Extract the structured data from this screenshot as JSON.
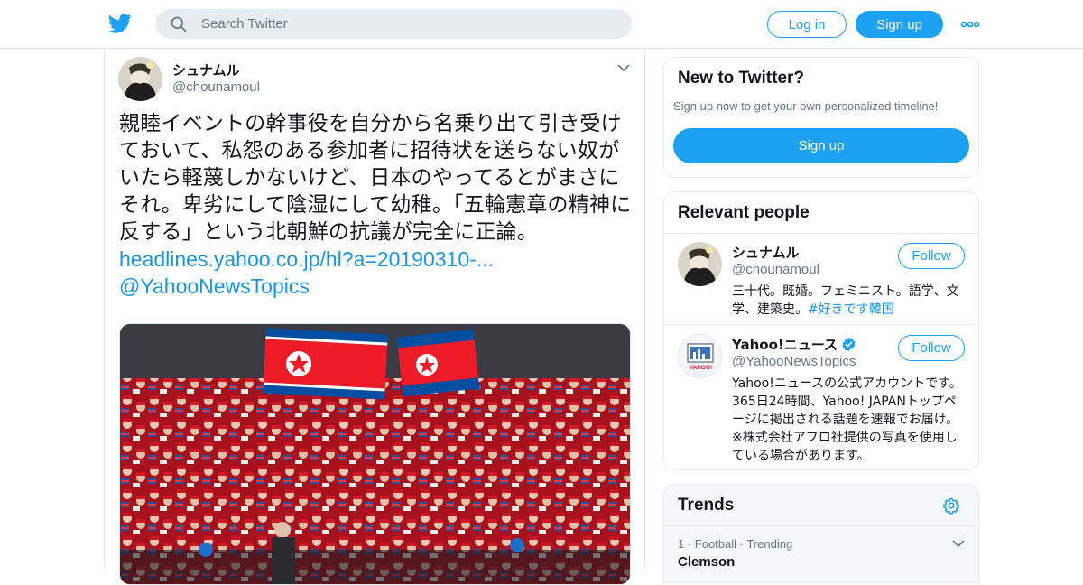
{
  "header": {
    "search_placeholder": "Search Twitter",
    "login_label": "Log in",
    "signup_label": "Sign up"
  },
  "tweet": {
    "author_name": "シュナムル",
    "author_handle": "@chounamoul",
    "text": "親睦イベントの幹事役を自分から名乗り出て引き受けておいて、私怨のある参加者に招待状を送らない奴がいたら軽蔑しかないけど、日本のやってるとがまさにそれ。卑劣にして陰湿にして幼稚。「五輪憲章の精神に反する」という北朝鮮の抗議が完全に正論。",
    "link": "headlines.yahoo.co.jp/hl?a=20190310-...",
    "mention": "@YahooNewsTopics"
  },
  "new_to_twitter": {
    "title": "New to Twitter?",
    "subtitle": "Sign up now to get your own personalized timeline!",
    "signup_label": "Sign up"
  },
  "relevant_people": {
    "title": "Relevant people",
    "people": [
      {
        "name": "シュナムル",
        "handle": "@chounamoul",
        "bio": "三十代。既婚。フェミニスト。語学、文学、建築史。",
        "hashtag": "#好きです韓国",
        "follow_label": "Follow"
      },
      {
        "name": "Yahoo!ニュース",
        "handle": "@YahooNewsTopics",
        "bio": "Yahoo!ニュースの公式アカウントです。365日24時間、Yahoo! JAPANトップページに掲出される話題を速報でお届け。※株式会社アフロ社提供の写真を使用している場合があります。",
        "follow_label": "Follow",
        "avatar_text": "YAHOO!"
      }
    ]
  },
  "trends": {
    "title": "Trends",
    "items": [
      {
        "meta": "1 · Football · Trending",
        "name": "Clemson"
      }
    ]
  },
  "colors": {
    "brand": "#1da1f2",
    "link": "#1b95e0",
    "secondary_text": "#657786"
  }
}
